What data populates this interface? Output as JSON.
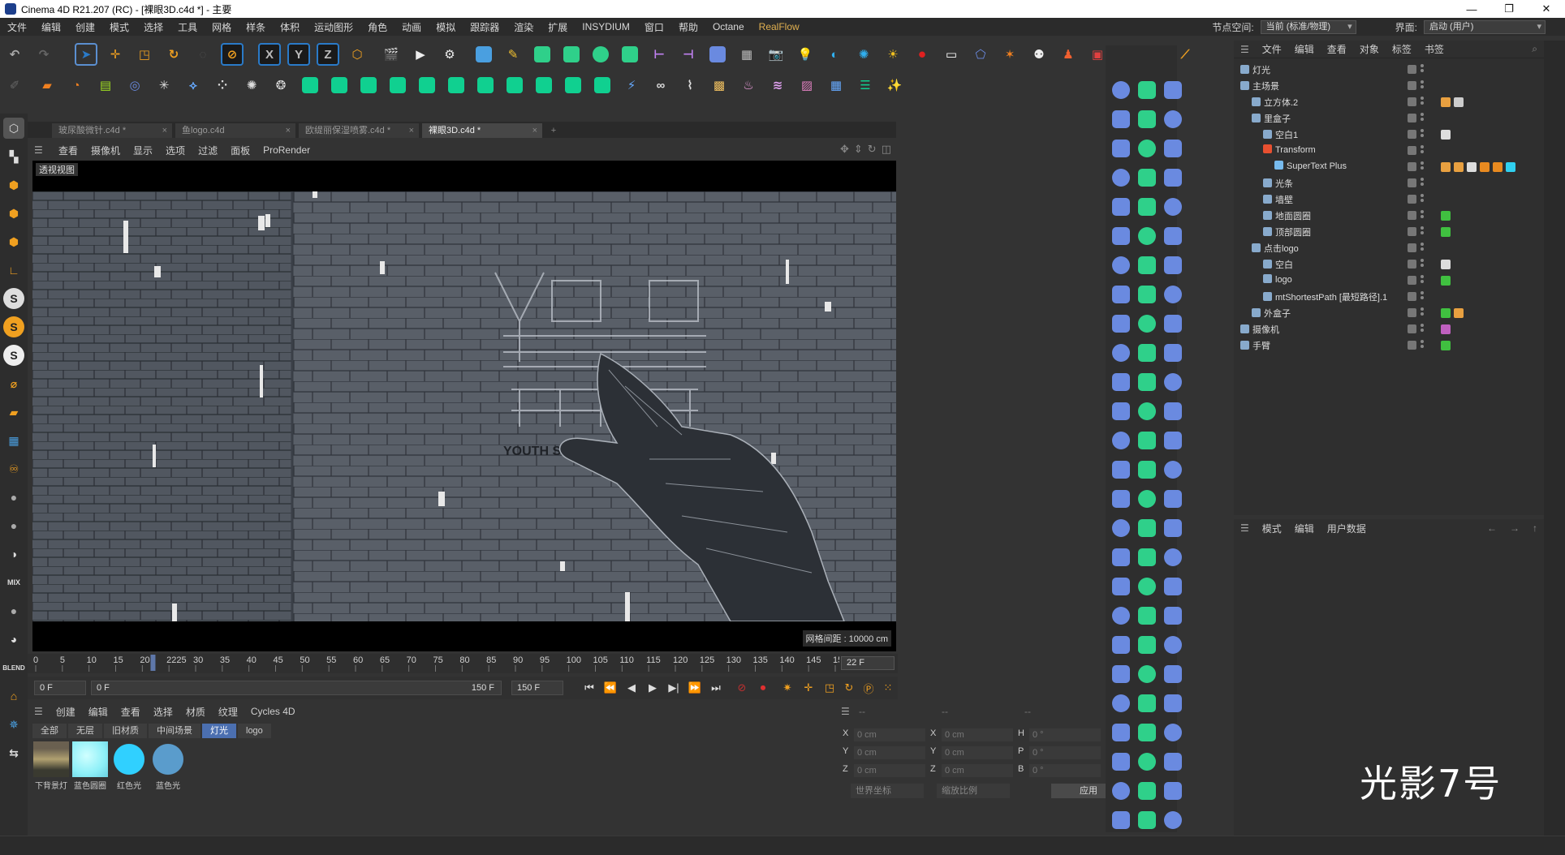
{
  "window": {
    "title": "Cinema 4D R21.207 (RC) - [裸眼3D.c4d *] - 主要",
    "controls": [
      "—",
      "❐",
      "✕"
    ]
  },
  "menubar": {
    "items": [
      "文件",
      "编辑",
      "创建",
      "模式",
      "选择",
      "工具",
      "网格",
      "样条",
      "体积",
      "运动图形",
      "角色",
      "动画",
      "模拟",
      "跟踪器",
      "渲染",
      "扩展",
      "INSYDIUM",
      "窗口",
      "帮助",
      "Octane",
      "RealFlow"
    ],
    "node_space_label": "节点空间:",
    "node_space_value": "当前 (标准/物理)",
    "layout_label": "界面:",
    "layout_value": "启动 (用户)"
  },
  "toolbar": {
    "axis_x": "X",
    "axis_y": "Y",
    "axis_z": "Z"
  },
  "document_tabs": [
    {
      "label": "玻尿酸微针.c4d *",
      "active": false
    },
    {
      "label": "鱼logo.c4d",
      "active": false
    },
    {
      "label": "欧缇丽保湿喷雾.c4d *",
      "active": false
    },
    {
      "label": "裸眼3D.c4d *",
      "active": true
    }
  ],
  "viewport": {
    "menu": [
      "查看",
      "摄像机",
      "显示",
      "选项",
      "过滤",
      "面板",
      "ProRender"
    ],
    "label": "透视视图",
    "grid_info": "网格间距 : 10000 cm",
    "scene_text": "YOUTH STARS GOT"
  },
  "timeline": {
    "ticks": [
      "0",
      "5",
      "10",
      "15",
      "20",
      "2225",
      "30",
      "35",
      "40",
      "45",
      "50",
      "55",
      "60",
      "65",
      "70",
      "75",
      "80",
      "85",
      "90",
      "95",
      "100",
      "105",
      "110",
      "115",
      "120",
      "125",
      "130",
      "135",
      "140",
      "145",
      "150"
    ],
    "current_frame": "22 F",
    "current_frame_value": 22,
    "max_frame": 150
  },
  "playback": {
    "start_frame": "0 F",
    "range_start": "0 F",
    "range_end": "150 F",
    "end_frame": "150 F"
  },
  "material_manager": {
    "menu": [
      "创建",
      "编辑",
      "查看",
      "选择",
      "材质",
      "纹理",
      "Cycles 4D"
    ],
    "filters": [
      {
        "label": "全部",
        "active": false
      },
      {
        "label": "无层",
        "active": false
      },
      {
        "label": "旧材质",
        "active": false
      },
      {
        "label": "中间场景",
        "active": false
      },
      {
        "label": "灯光",
        "active": true
      },
      {
        "label": "logo",
        "active": false
      }
    ],
    "materials": [
      {
        "name": "下背景灯",
        "color": "#9a9070"
      },
      {
        "name": "蓝色圆圈",
        "color": "#8ef0f8"
      },
      {
        "name": "红色光",
        "color": "#10b8f0"
      },
      {
        "name": "蓝色光",
        "color": "#5a9ccc"
      }
    ]
  },
  "coordinates": {
    "headers": [
      "--",
      "--",
      "--"
    ],
    "rows": [
      {
        "a_label": "X",
        "a_value": "0 cm",
        "b_label": "X",
        "b_value": "0 cm",
        "c_label": "H",
        "c_value": "0 °"
      },
      {
        "a_label": "Y",
        "a_value": "0 cm",
        "b_label": "Y",
        "b_value": "0 cm",
        "c_label": "P",
        "c_value": "0 °"
      },
      {
        "a_label": "Z",
        "a_value": "0 cm",
        "b_label": "Z",
        "b_value": "0 cm",
        "c_label": "B",
        "c_value": "0 °"
      }
    ],
    "coord_mode": "世界坐标",
    "scale_mode": "缩放比例",
    "apply_label": "应用"
  },
  "object_manager": {
    "menu": [
      "文件",
      "编辑",
      "查看",
      "对象",
      "标签",
      "书签"
    ],
    "objects": [
      {
        "name": "灯光",
        "level": 0,
        "icon_color": "#88aacc",
        "tags": []
      },
      {
        "name": "主场景",
        "level": 0,
        "icon_color": "#88aacc",
        "tags": []
      },
      {
        "name": "立方体.2",
        "level": 1,
        "icon_color": "#88aacc",
        "tags": [
          "#e8a040",
          "#cccccc"
        ]
      },
      {
        "name": "里盒子",
        "level": 1,
        "icon_color": "#88aacc",
        "tags": []
      },
      {
        "name": "空白1",
        "level": 2,
        "icon_color": "#88aacc",
        "tags": [
          "#dddddd"
        ]
      },
      {
        "name": "Transform",
        "level": 2,
        "icon_color": "#e85030",
        "tags": []
      },
      {
        "name": "SuperText Plus",
        "level": 3,
        "icon_color": "#77bbee",
        "tags": [
          "#e8a040",
          "#e8a040",
          "#dddddd",
          "#e88a20",
          "#e88a20",
          "#30d0f0"
        ]
      },
      {
        "name": "光条",
        "level": 2,
        "icon_color": "#88aacc",
        "tags": []
      },
      {
        "name": "墙壁",
        "level": 2,
        "icon_color": "#88aacc",
        "tags": []
      },
      {
        "name": "地面圆圈",
        "level": 2,
        "icon_color": "#88aacc",
        "tags": [
          "#40c040"
        ]
      },
      {
        "name": "顶部圆圈",
        "level": 2,
        "icon_color": "#88aacc",
        "tags": [
          "#40c040"
        ]
      },
      {
        "name": "点击logo",
        "level": 1,
        "icon_color": "#88aacc",
        "tags": []
      },
      {
        "name": "空白",
        "level": 2,
        "icon_color": "#88aacc",
        "tags": [
          "#dddddd"
        ]
      },
      {
        "name": "logo",
        "level": 2,
        "icon_color": "#88aacc",
        "tags": [
          "#40c040"
        ]
      },
      {
        "name": "mtShortestPath [最短路径].1",
        "level": 2,
        "icon_color": "#88aacc",
        "tags": []
      },
      {
        "name": "外盒子",
        "level": 1,
        "icon_color": "#88aacc",
        "tags": [
          "#40c040",
          "#e8a040"
        ]
      },
      {
        "name": "摄像机",
        "level": 0,
        "icon_color": "#88aacc",
        "tags": [
          "#c060c0"
        ]
      },
      {
        "name": "手臂",
        "level": 0,
        "icon_color": "#88aacc",
        "tags": [
          "#40c040"
        ]
      }
    ]
  },
  "attribute_manager": {
    "menu": [
      "模式",
      "编辑",
      "用户数据"
    ]
  },
  "watermark": "光影7号",
  "colors": {
    "accent": "#4b6fb0",
    "realflow": "#e0b050",
    "background": "#333333"
  }
}
